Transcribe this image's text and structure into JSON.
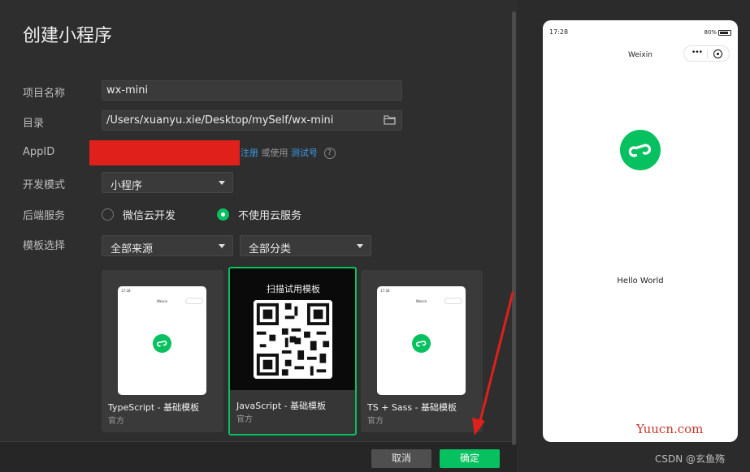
{
  "dialog": {
    "title": "创建小程序",
    "fields": {
      "project_name_label": "项目名称",
      "project_name_value": "wx-mini",
      "directory_label": "目录",
      "directory_value": "/Users/xuanyu.xie/Desktop/mySelf/wx-mini",
      "appid_label": "AppID",
      "appid_register_link": "注册",
      "appid_or_use": "或使用",
      "appid_test_link": "测试号",
      "dev_mode_label": "开发模式",
      "dev_mode_value": "小程序",
      "backend_label": "后端服务",
      "backend_option_cloud": "微信云开发",
      "backend_option_none": "不使用云服务",
      "backend_selected": "不使用云服务",
      "template_label": "模板选择",
      "template_source_value": "全部来源",
      "template_category_value": "全部分类"
    },
    "templates": [
      {
        "name": "TypeScript - 基础模板",
        "author": "官方",
        "selected": false
      },
      {
        "name": "JavaScript - 基础模板",
        "author": "官方",
        "selected": true,
        "overlay_label": "扫描试用模板"
      },
      {
        "name": "TS + Sass - 基础模板",
        "author": "官方",
        "selected": false
      }
    ],
    "footer": {
      "cancel_label": "取消",
      "confirm_label": "确定"
    }
  },
  "preview": {
    "time": "17:28",
    "battery": "80%",
    "nav_title": "Weixin",
    "body_text": "Hello World",
    "capsule_dots": "•••",
    "template_phone_time": "17:28",
    "template_phone_title": "Weixin"
  },
  "watermarks": {
    "site": "Yuucn.com",
    "author": "CSDN @玄鱼殇"
  },
  "colors": {
    "accent": "#07c160",
    "link": "#3b9eea",
    "redaction": "#e0201a",
    "annotation_arrow": "#e0201a"
  }
}
